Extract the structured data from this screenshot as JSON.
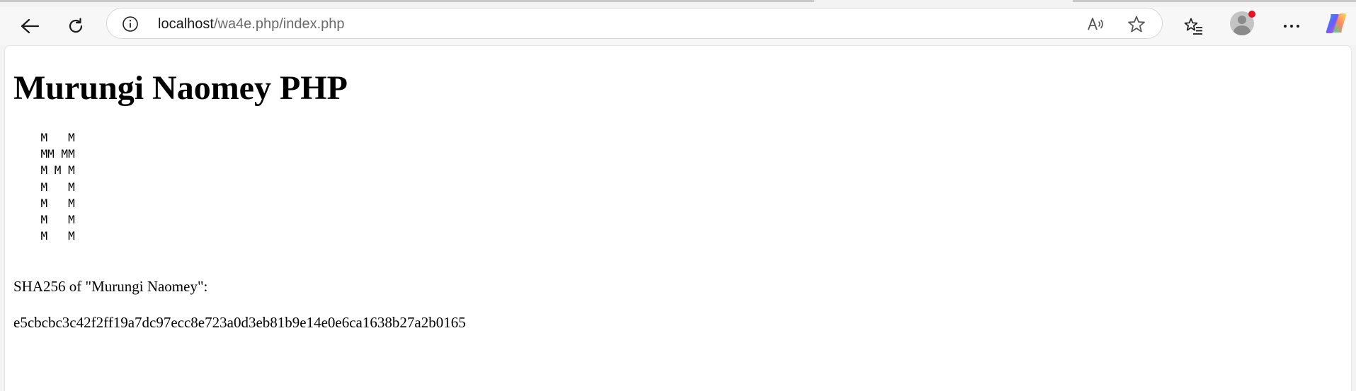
{
  "browser": {
    "address": {
      "host": "localhost",
      "path": "/wa4e.php/index.php"
    },
    "icons": {
      "back": "back-arrow-icon",
      "refresh": "refresh-icon",
      "info": "info-icon",
      "read_aloud": "read-aloud-icon",
      "favorite": "star-icon",
      "favorites": "favorites-list-icon",
      "profile": "profile-avatar-icon",
      "more": "more-icon",
      "copilot": "copilot-icon"
    },
    "colors": {
      "notification_dot": "#e81123"
    }
  },
  "page": {
    "heading": "Murungi Naomey PHP",
    "ascii_art": "    M   M\n    MM MM\n    M M M\n    M   M\n    M   M\n    M   M\n    M   M",
    "sha_label": "SHA256 of \"Murungi Naomey\":",
    "sha_value": "e5cbcbc3c42f2ff19a7dc97ecc8e723a0d3eb81b9e14e0e6ca1638b27a2b0165"
  }
}
